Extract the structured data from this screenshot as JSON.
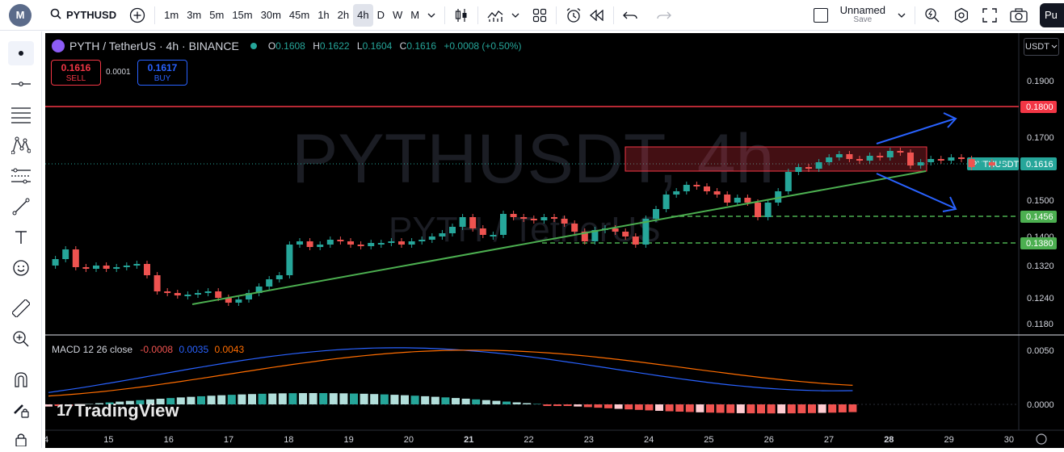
{
  "toolbar": {
    "symbol": "PYTHUSD",
    "intervals": [
      "1m",
      "3m",
      "5m",
      "15m",
      "30m",
      "45m",
      "1h",
      "2h",
      "4h",
      "D",
      "W",
      "M"
    ],
    "active_interval": "4h",
    "layout_name": "Unnamed",
    "layout_save": "Save",
    "publish_label": "Pu"
  },
  "legend": {
    "title": "PYTH / TetherUS · 4h · BINANCE",
    "o_label": "O",
    "o": "0.1608",
    "h_label": "H",
    "h": "0.1622",
    "l_label": "L",
    "l": "0.1604",
    "c_label": "C",
    "c": "0.1616",
    "change": "+0.0008 (+0.50%)"
  },
  "trade": {
    "sell_price": "0.1616",
    "sell_label": "SELL",
    "spread": "0.0001",
    "buy_price": "0.1617",
    "buy_label": "BUY"
  },
  "currency": "USDT",
  "watermark": {
    "main": "PYTHUSDT, 4h",
    "sub": "PYTH / TetherUS"
  },
  "price_axis": [
    "0.1900",
    "0.1700",
    "0.1500",
    "0.1400",
    "0.1320",
    "0.1240",
    "0.1180"
  ],
  "price_badges": {
    "resistance": "0.1800",
    "current_symbol": "PYTHUSDT",
    "current": "0.1616",
    "support1": "0.1456",
    "support2": "0.1380"
  },
  "macd": {
    "label": "MACD 12 26 close",
    "hist": "-0.0008",
    "macd": "0.0035",
    "signal": "0.0043",
    "axis": [
      "0.0050",
      "0.0000"
    ]
  },
  "time_axis": [
    "4",
    "15",
    "16",
    "17",
    "18",
    "19",
    "20",
    "21",
    "22",
    "23",
    "24",
    "25",
    "26",
    "27",
    "28",
    "29",
    "30"
  ],
  "brand": "TradingView",
  "colors": {
    "up": "#26a69a",
    "down": "#ef5350",
    "resistance": "#f23645",
    "support": "#4caf50",
    "arrow": "#2962ff",
    "macd": "#2962ff",
    "signal": "#ff6d00"
  }
}
